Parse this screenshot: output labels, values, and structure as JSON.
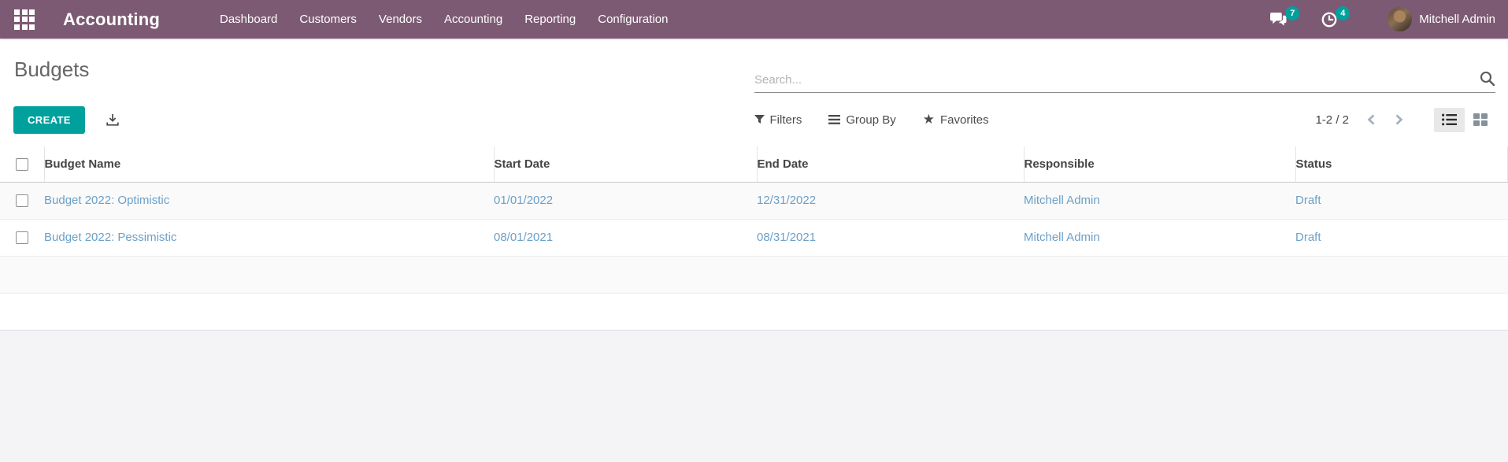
{
  "navbar": {
    "app_name": "Accounting",
    "menu_items": [
      "Dashboard",
      "Customers",
      "Vendors",
      "Accounting",
      "Reporting",
      "Configuration"
    ],
    "messages_badge": "7",
    "activities_badge": "4",
    "user_name": "Mitchell Admin"
  },
  "control_panel": {
    "title": "Budgets",
    "search_placeholder": "Search...",
    "create_label": "CREATE",
    "filters_label": "Filters",
    "group_by_label": "Group By",
    "favorites_label": "Favorites",
    "pager_text": "1-2 / 2"
  },
  "table": {
    "headers": [
      "Budget Name",
      "Start Date",
      "End Date",
      "Responsible",
      "Status"
    ],
    "rows": [
      {
        "name": "Budget 2022: Optimistic",
        "start_date": "01/01/2022",
        "end_date": "12/31/2022",
        "responsible": "Mitchell Admin",
        "status": "Draft"
      },
      {
        "name": "Budget 2022: Pessimistic",
        "start_date": "08/01/2021",
        "end_date": "08/31/2021",
        "responsible": "Mitchell Admin",
        "status": "Draft"
      }
    ]
  },
  "colors": {
    "navbar_bg": "#7d5a73",
    "accent_teal": "#00a09d",
    "row_link_blue": "#6ba0c8"
  }
}
